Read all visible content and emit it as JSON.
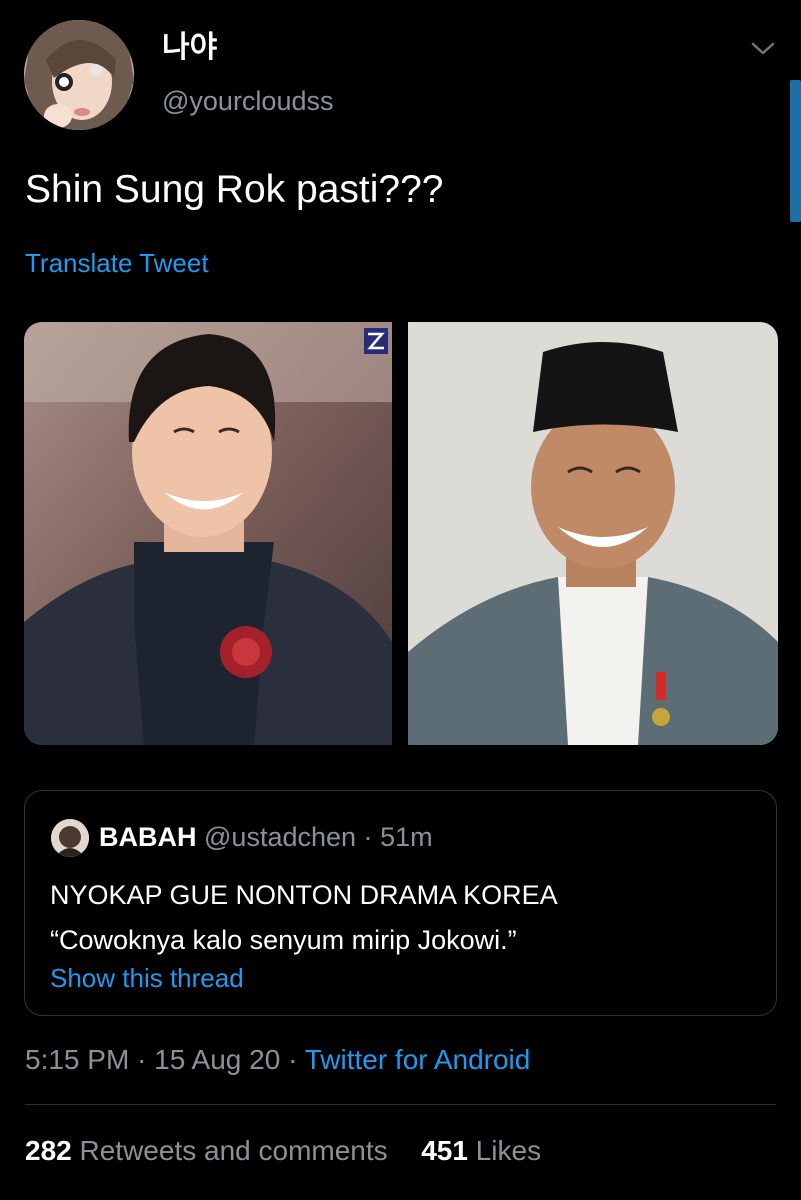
{
  "author": {
    "display_name": "나야",
    "handle": "@yourcloudss"
  },
  "tweet": {
    "text": "Shin Sung Rok pasti???",
    "translate_label": "Translate Tweet"
  },
  "quoted_tweet": {
    "name": "BABAH",
    "handle": "@ustadchen",
    "separator": "·",
    "time": "51m",
    "line1": "NYOKAP GUE NONTON DRAMA KOREA",
    "line2": "“Cowoknya kalo senyum mirip Jokowi.”",
    "show_thread_label": "Show this thread"
  },
  "meta": {
    "time": "5:15 PM",
    "separator": "·",
    "date": "15 Aug 20",
    "source": "Twitter for Android"
  },
  "stats": {
    "retweets_count": "282",
    "retweets_label": "Retweets and comments",
    "likes_count": "451",
    "likes_label": "Likes"
  },
  "icons": {
    "more": "chevron-down-icon"
  },
  "colors": {
    "background": "#000000",
    "link": "#1d9bf0",
    "secondary_text": "#8a9299",
    "border": "#2f3336",
    "scrollbar": "#1d6fa8"
  }
}
